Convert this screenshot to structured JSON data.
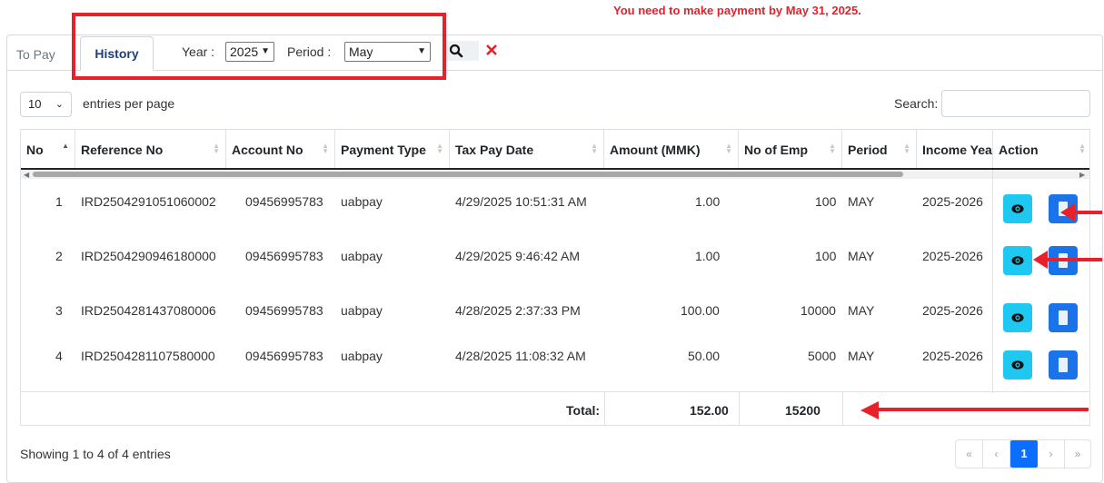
{
  "notice": "You need to make payment by May 31, 2025.",
  "tabs": {
    "to_pay": "To Pay",
    "history": "History"
  },
  "filters": {
    "year_label": "Year :",
    "year_value": "2025",
    "period_label": "Period :",
    "period_value": "May"
  },
  "entries": {
    "value": "10",
    "label": "entries per page"
  },
  "search": {
    "label": "Search:"
  },
  "table": {
    "headers": [
      "No",
      "Reference No",
      "Account No",
      "Payment Type",
      "Tax Pay Date",
      "Amount (MMK)",
      "No of Emp",
      "Period",
      "Income Yea",
      "Action"
    ],
    "rows": [
      {
        "no": "1",
        "reference": "IRD2504291051060002",
        "account": "09456995783",
        "payment_type": "uabpay",
        "date": "4/29/2025 10:51:31 AM",
        "amount": "1.00",
        "emp": "100",
        "period": "MAY",
        "income_year": "2025-2026"
      },
      {
        "no": "2",
        "reference": "IRD2504290946180000",
        "account": "09456995783",
        "payment_type": "uabpay",
        "date": "4/29/2025 9:46:42 AM",
        "amount": "1.00",
        "emp": "100",
        "period": "MAY",
        "income_year": "2025-2026"
      },
      {
        "no": "3",
        "reference": "IRD2504281437080006",
        "account": "09456995783",
        "payment_type": "uabpay",
        "date": "4/28/2025 2:37:33 PM",
        "amount": "100.00",
        "emp": "10000",
        "period": "MAY",
        "income_year": "2025-2026"
      },
      {
        "no": "4",
        "reference": "IRD2504281107580000",
        "account": "09456995783",
        "payment_type": "uabpay",
        "date": "4/28/2025 11:08:32 AM",
        "amount": "50.00",
        "emp": "5000",
        "period": "MAY",
        "income_year": "2025-2026"
      }
    ],
    "total_label": "Total:",
    "total_amount": "152.00",
    "total_emp": "15200"
  },
  "footer": {
    "showing": "Showing 1 to 4 of 4 entries"
  },
  "pagination": {
    "first": "«",
    "prev": "‹",
    "current": "1",
    "next": "›",
    "last": "»"
  },
  "colors": {
    "accent_red": "#e8202a",
    "view_button": "#1ec8f0",
    "receipt_button": "#1a73e8",
    "active_page": "#0d6efd",
    "tab_text": "#1f3f7a"
  },
  "icons": {
    "view": "eye-icon",
    "receipt": "document-icon",
    "search": "search-icon",
    "clear": "close-icon"
  }
}
